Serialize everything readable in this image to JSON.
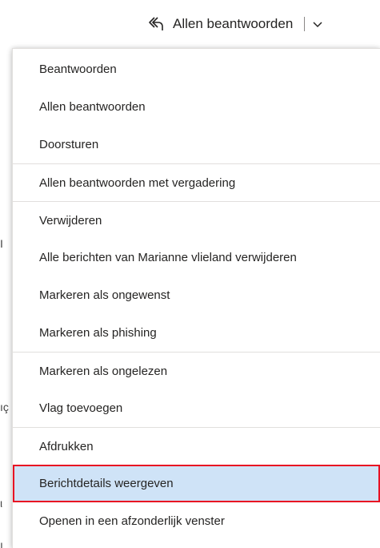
{
  "toolbar": {
    "reply_all_label": "Allen beantwoorden",
    "reply_icon": "reply-all-icon",
    "dropdown_icon": "chevron-down-icon"
  },
  "menu": {
    "items": [
      {
        "label": "Beantwoorden"
      },
      {
        "label": "Allen beantwoorden"
      },
      {
        "label": "Doorsturen"
      },
      {
        "label": "Allen beantwoorden met vergadering"
      },
      {
        "label": "Verwijderen"
      },
      {
        "label": "Alle berichten van Marianne vlieland verwijderen"
      },
      {
        "label": "Markeren als ongewenst"
      },
      {
        "label": "Markeren als phishing"
      },
      {
        "label": "Markeren als ongelezen"
      },
      {
        "label": "Vlag toevoegen"
      },
      {
        "label": "Afdrukken"
      },
      {
        "label": "Berichtdetails weergeven"
      },
      {
        "label": "Openen in een afzonderlijk venster"
      }
    ]
  },
  "colors": {
    "highlight_bg": "#cfe3f7",
    "highlight_border": "#e81123",
    "text": "#252423"
  }
}
